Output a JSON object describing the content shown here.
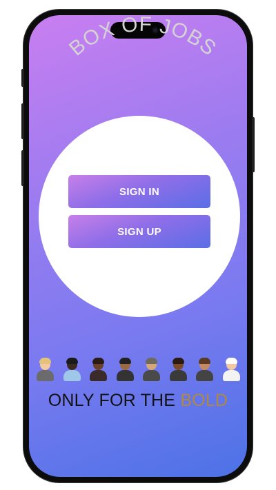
{
  "app": {
    "title": "BOX OF JOBS"
  },
  "auth": {
    "sign_in_label": "SIGN IN",
    "sign_up_label": "SIGN UP"
  },
  "people": [
    {
      "icon": "woman-technologist-icon",
      "skin": "#f2c9a0",
      "hair": "#e3c27a",
      "body": "#6b6b6b"
    },
    {
      "icon": "man-office-worker-icon",
      "skin": "#3b2a22",
      "hair": "#1b1b1b",
      "body": "#9ec7e8"
    },
    {
      "icon": "woman-cook-icon",
      "skin": "#6a3f2b",
      "hair": "#2a1a14",
      "body": "#3a2a2a"
    },
    {
      "icon": "man-graduate-icon",
      "skin": "#9b6a45",
      "hair": "#222222",
      "body": "#333333"
    },
    {
      "icon": "firefighter-icon",
      "skin": "#d6a77a",
      "hair": "#6e6a5e",
      "body": "#4a4a4a"
    },
    {
      "icon": "man-mechanic-icon",
      "skin": "#7a4a2d",
      "hair": "#2a1a12",
      "body": "#3a3a3a"
    },
    {
      "icon": "woman-office-worker-icon",
      "skin": "#c48a62",
      "hair": "#5a3a22",
      "body": "#444444"
    },
    {
      "icon": "man-health-worker-icon",
      "skin": "#f0c9a2",
      "hair": "#ffffff",
      "body": "#f3f3f3"
    }
  ],
  "tagline": {
    "prefix": "ONLY FOR THE ",
    "accent": "BOLD"
  },
  "colors": {
    "gradient_start": "#c97ef0",
    "gradient_end": "#4c72e6",
    "accent_gold": "#b08940",
    "title_gray": "#d3d3d3"
  }
}
